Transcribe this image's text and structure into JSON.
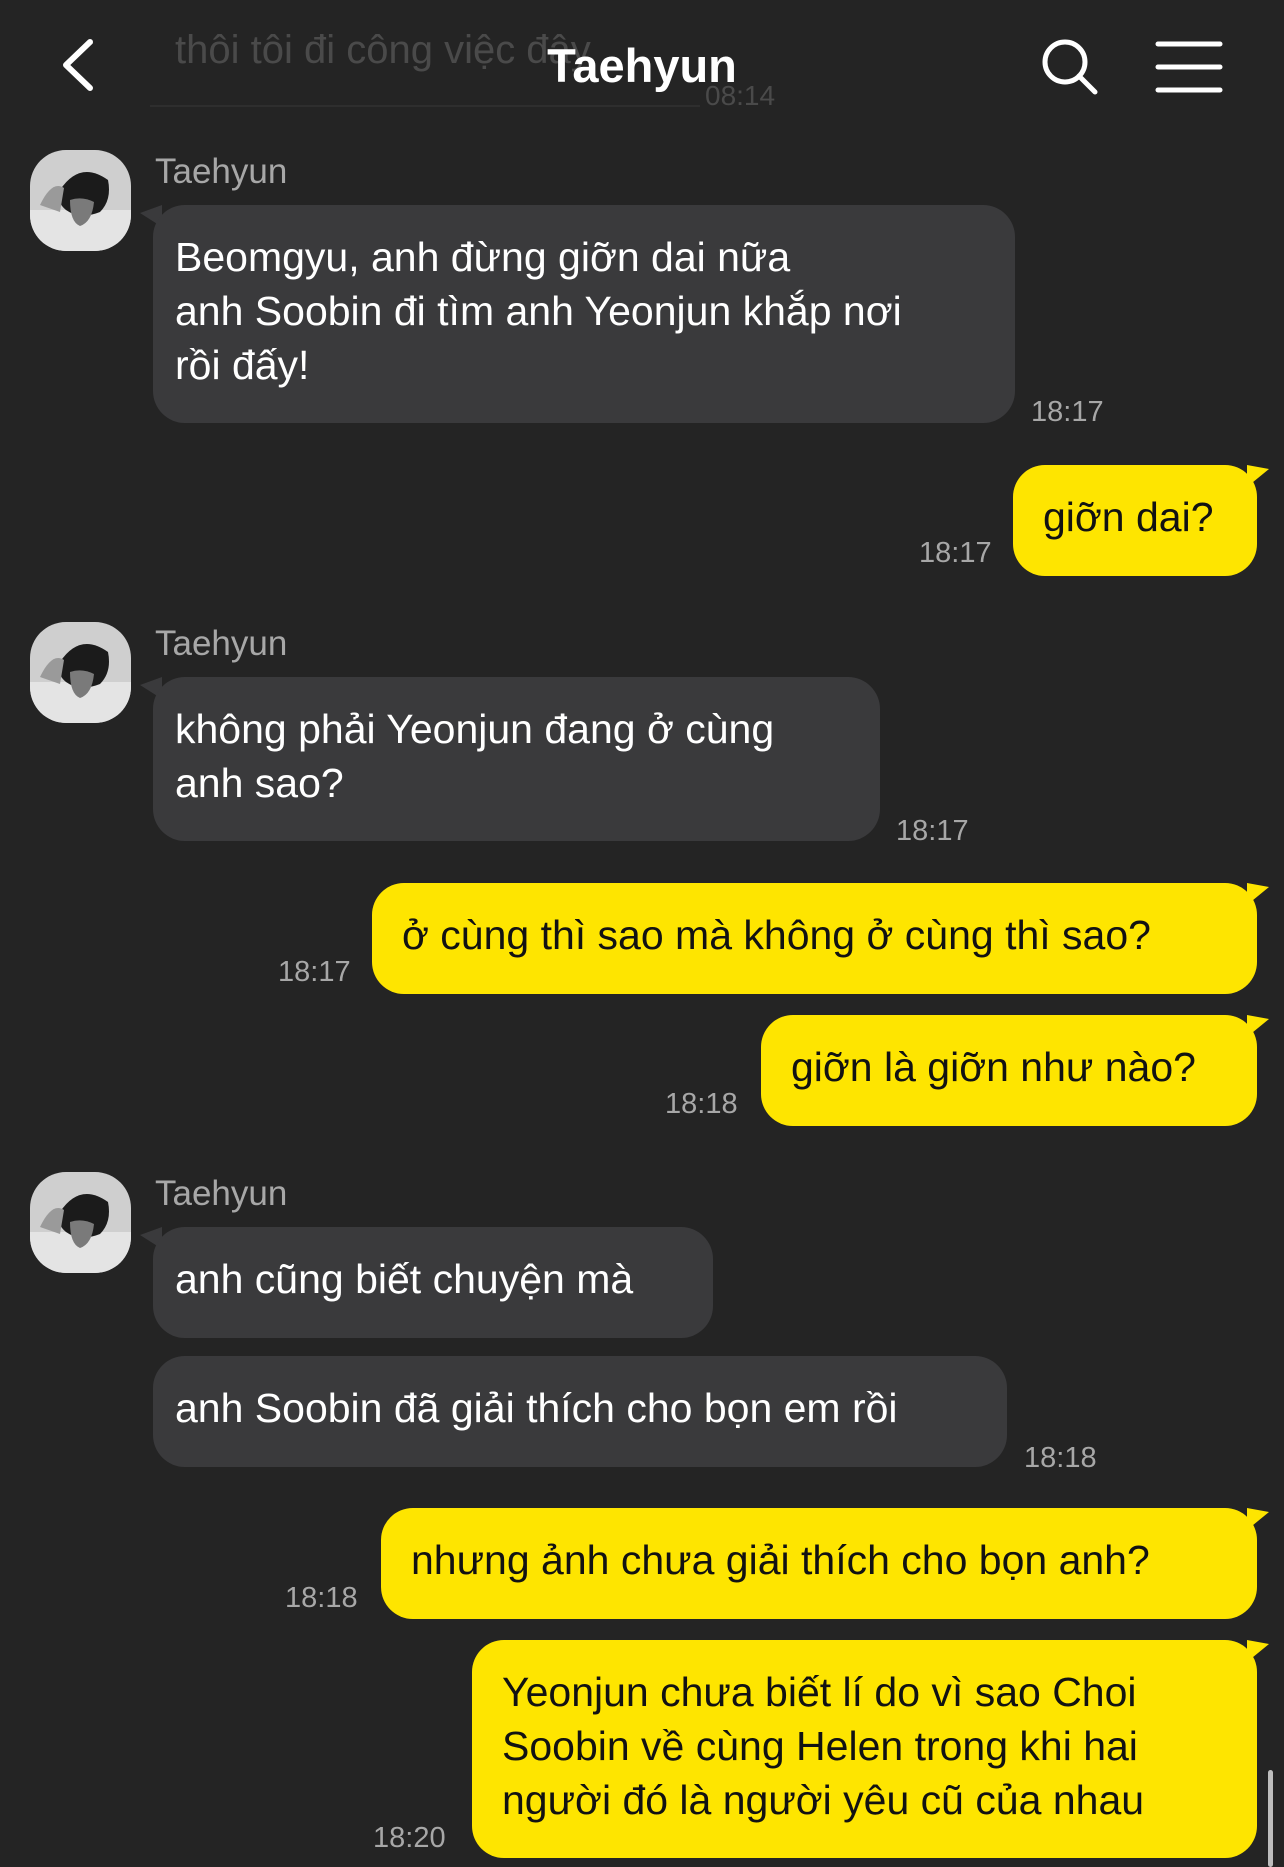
{
  "header": {
    "title": "Taehyun",
    "background_preview_text": "thôi tôi đi công việc đây",
    "background_preview_time": "08:14"
  },
  "icons": {
    "back": "chevron-left-icon",
    "search": "search-icon",
    "menu": "hamburger-menu-icon"
  },
  "colors": {
    "background": "#242424",
    "incoming_bubble": "#3a3a3c",
    "outgoing_bubble": "#fee500",
    "timestamp": "#a7a7a7"
  },
  "messages": [
    {
      "side": "in",
      "sender": "Taehyun",
      "text": "Beomgyu, anh đừng giỡn dai nữa\nanh Soobin đi tìm anh Yeonjun khắp nơi\nrồi đấy!",
      "time": "18:17"
    },
    {
      "side": "out",
      "text": "giỡn dai?",
      "time": "18:17"
    },
    {
      "side": "in",
      "sender": "Taehyun",
      "text": "không phải Yeonjun đang ở cùng\nanh sao?",
      "time": "18:17"
    },
    {
      "side": "out",
      "text": "ở cùng thì sao mà không ở cùng thì sao?",
      "time": "18:17"
    },
    {
      "side": "out",
      "text": "giỡn là giỡn như nào?",
      "time": "18:18"
    },
    {
      "side": "in",
      "sender": "Taehyun",
      "text": "anh cũng biết chuyện mà",
      "time": ""
    },
    {
      "side": "in",
      "text": "anh Soobin đã giải thích cho bọn em rồi",
      "time": "18:18"
    },
    {
      "side": "out",
      "text": "nhưng ảnh chưa giải thích cho bọn anh?",
      "time": "18:18"
    },
    {
      "side": "out",
      "text": "Yeonjun chưa biết lí do vì sao Choi\nSoobin về cùng Helen trong khi hai\nngười đó là người yêu cũ của nhau",
      "time": "18:20"
    }
  ]
}
